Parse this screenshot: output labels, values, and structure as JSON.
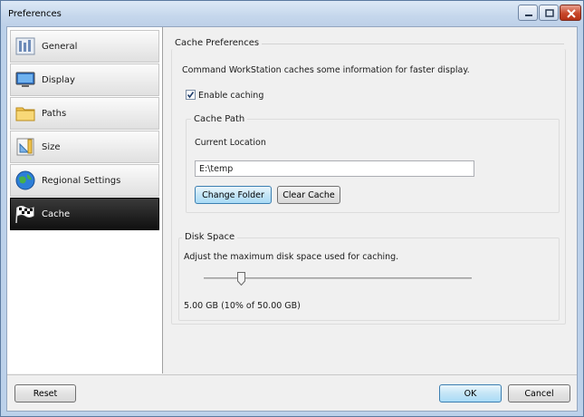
{
  "window": {
    "title": "Preferences"
  },
  "sidebar": {
    "items": [
      {
        "label": "General",
        "icon": "general-icon"
      },
      {
        "label": "Display",
        "icon": "display-icon"
      },
      {
        "label": "Paths",
        "icon": "folder-icon"
      },
      {
        "label": "Size",
        "icon": "size-icon"
      },
      {
        "label": "Regional Settings",
        "icon": "globe-icon"
      },
      {
        "label": "Cache",
        "icon": "checkered-flag-icon",
        "selected": true
      }
    ]
  },
  "cache": {
    "section_title": "Cache Preferences",
    "description": "Command WorkStation caches some information for faster display.",
    "enable_label": "Enable caching",
    "enable_checked": true,
    "path_group": {
      "title": "Cache Path",
      "current_location_label": "Current Location",
      "location_value": "E:\\temp",
      "change_folder_label": "Change Folder",
      "clear_cache_label": "Clear Cache"
    },
    "disk_group": {
      "title": "Disk Space",
      "description": "Adjust the maximum disk space used for caching.",
      "slider_fraction": 0.1,
      "value_text": "5.00 GB (10% of 50.00 GB)"
    }
  },
  "footer": {
    "reset_label": "Reset",
    "ok_label": "OK",
    "cancel_label": "Cancel"
  },
  "colors": {
    "title_bar": "#c5d7ec",
    "selected_nav": "#101010",
    "focus_button": "#c4e5f6",
    "close_button": "#c8482b"
  }
}
